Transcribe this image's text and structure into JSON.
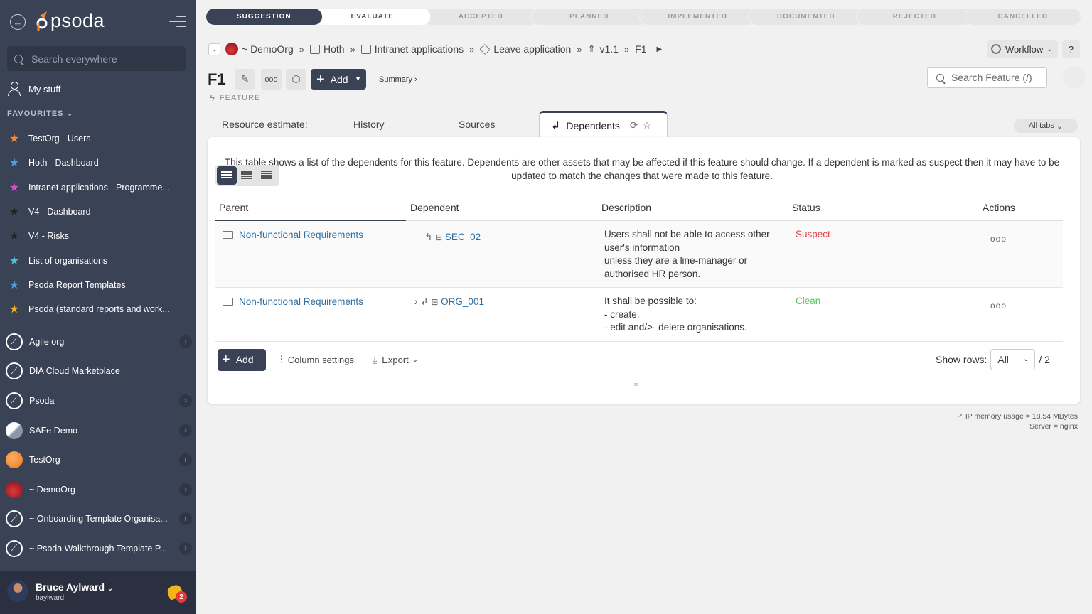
{
  "app": {
    "logo_text": "psoda",
    "accent": "#3a4256",
    "sidebar_bg": "#3a4256"
  },
  "sidebar": {
    "search_placeholder": "Search everywhere",
    "my_stuff": "My stuff",
    "favourites_label": "FAVOURITES",
    "favourites": [
      {
        "label": "TestOrg - Users",
        "color": "#f28a3c"
      },
      {
        "label": "Hoth - Dashboard",
        "color": "#4aa3df"
      },
      {
        "label": "Intranet applications - Programme...",
        "color": "#d94bd1"
      },
      {
        "label": "V4 - Dashboard",
        "color": "#222222"
      },
      {
        "label": "V4 - Risks",
        "color": "#222222"
      },
      {
        "label": "List of organisations",
        "color": "#4fc1d8"
      },
      {
        "label": "Psoda Report Templates",
        "color": "#4aa3df"
      },
      {
        "label": "Psoda (standard reports and work...",
        "color": "#f3b51b"
      }
    ],
    "orgs": [
      {
        "label": "Agile org",
        "icon": "compass-icon"
      },
      {
        "label": "DIA Cloud Marketplace",
        "icon": "compass-icon"
      },
      {
        "label": "Psoda",
        "icon": "compass-icon"
      },
      {
        "label": "SAFe Demo",
        "icon": "snow-icon"
      },
      {
        "label": "TestOrg",
        "icon": "orange-org-icon"
      },
      {
        "label": "~ DemoOrg",
        "icon": "red-org-icon"
      },
      {
        "label": "~ Onboarding Template Organisa...",
        "icon": "compass-icon"
      },
      {
        "label": "~ Psoda Walkthrough Template P...",
        "icon": "compass-icon"
      }
    ],
    "user": {
      "name": "Bruce Aylward",
      "handle": "baylward",
      "notifications": "2"
    }
  },
  "stages": [
    "SUGGESTION",
    "EVALUATE",
    "ACCEPTED",
    "PLANNED",
    "IMPLEMENTED",
    "DOCUMENTED",
    "REJECTED",
    "CANCELLED"
  ],
  "breadcrumb": [
    "~ DemoOrg",
    "Hoth",
    "Intranet applications",
    "Leave application",
    "v1.1",
    "F1"
  ],
  "header": {
    "workflow": "Workflow",
    "help": "?",
    "item_id": "F1",
    "add": "Add",
    "summary": "Summary ›",
    "item_type": "FEATURE",
    "search_placeholder": "Search Feature (/)"
  },
  "tabs": [
    "Resource estimate:",
    "History",
    "Sources",
    "Dependents"
  ],
  "all_tabs": "All tabs",
  "panel": {
    "intro": "This table shows a list of the dependents for this feature. Dependents are other assets that may be affected if this feature should change. If a dependent is marked as suspect then it may have to be updated to match the changes that were made to this feature.",
    "columns": [
      "Parent",
      "Dependent",
      "Description",
      "Status",
      "Actions"
    ],
    "rows": [
      {
        "parent": "Non-functional Requirements",
        "dependent": "SEC_02",
        "description": [
          "Users shall not be able to access other",
          "user's information",
          "unless they are a line-manager or",
          "authorised HR person."
        ],
        "status": "Suspect"
      },
      {
        "parent": "Non-functional Requirements",
        "dependent": "ORG_001",
        "description": [
          "It shall be possible to:",
          "- create,",
          "- edit and/>- delete organisations."
        ],
        "status": "Clean"
      }
    ],
    "add": "Add",
    "column_settings": "Column settings",
    "export": "Export",
    "show_rows_label": "Show rows:",
    "show_rows_value": "All",
    "total": "/ 2",
    "status_colors": {
      "suspect": "#e0474c",
      "clean": "#4ccc4c"
    }
  },
  "footer": {
    "memory": "PHP memory usage = 18.54 MBytes",
    "server": "Server = nginx"
  }
}
